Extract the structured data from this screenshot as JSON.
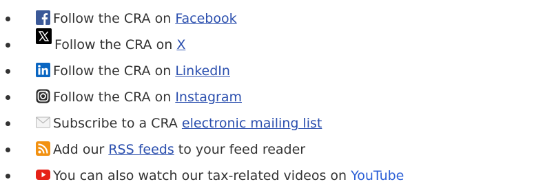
{
  "items": [
    {
      "icon": "facebook-icon",
      "prefix": "Follow the CRA on ",
      "link": "Facebook",
      "suffix": ""
    },
    {
      "icon": "x-icon",
      "prefix": "Follow the CRA on ",
      "link": "X",
      "suffix": ""
    },
    {
      "icon": "linkedin-icon",
      "prefix": "Follow the CRA on ",
      "link": "LinkedIn",
      "suffix": ""
    },
    {
      "icon": "instagram-icon",
      "prefix": "Follow the CRA on ",
      "link": "Instagram",
      "suffix": ""
    },
    {
      "icon": "email-icon",
      "prefix": "Subscribe to a CRA ",
      "link": "electronic mailing list",
      "suffix": ""
    },
    {
      "icon": "rss-icon",
      "prefix": "Add our ",
      "link": "RSS feeds",
      "suffix": " to your feed reader"
    },
    {
      "icon": "youtube-icon",
      "prefix": "You can also watch our tax-related videos on ",
      "link": "YouTube",
      "suffix": ""
    }
  ],
  "colors": {
    "facebook": "#3b5998",
    "x": "#000000",
    "linkedin": "#0a66c2",
    "instagram": "#2b2b2b",
    "email": "#b9b9b9",
    "rss": "#f29111",
    "youtube": "#e62117",
    "link": "#284162"
  }
}
